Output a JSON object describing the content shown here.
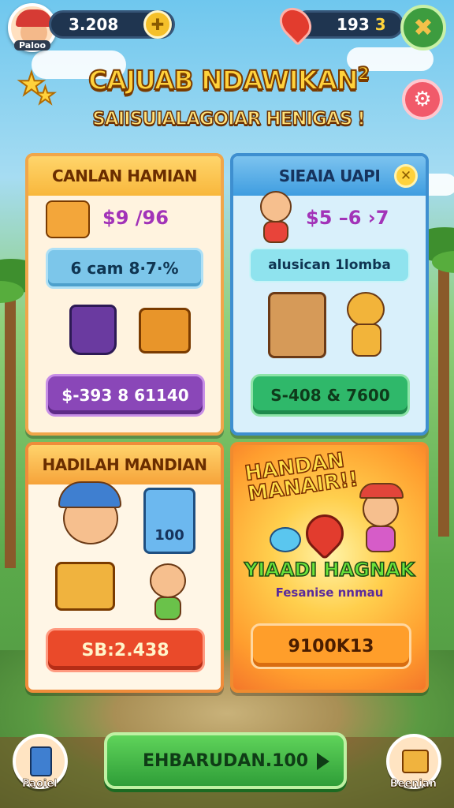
{
  "topbar": {
    "player_name": "Paloo",
    "coins": "3.208",
    "gems_prefix": "193",
    "gems_suffix": "3"
  },
  "title": "CAJUAB NDAWIKAN",
  "title_sup": "2",
  "subtitle": "SAIISUIALAGOIAR HENIGAS !",
  "cards": {
    "card1": {
      "header": "CANLAN HAMIAN",
      "price": "$9 /96",
      "bar": "6 cam 8·7·%",
      "button": "$-393 8 61140"
    },
    "card2": {
      "header": "SIEAIA UAPI",
      "price": "$5 –6 ›7",
      "bar": "alusican 1lomba",
      "button": "S-408 & 7600"
    },
    "card3": {
      "header": "HADILAH MANDIAN",
      "tablet_text": "100",
      "button": "SB:2.438"
    },
    "card4": {
      "header_line1": "HANDAN",
      "header_line2": "MANAIR!!",
      "subheading": "YIAADI HAGNAK",
      "caption": "Fesanise nnmau",
      "button": "9100K13"
    }
  },
  "bottom": {
    "main_button": "EHBARUDAN.100",
    "left_label": "Paoiel",
    "right_label": "Beenian"
  },
  "colors": {
    "title_fill": "#ffd23c",
    "card1_border": "#f0a64a",
    "card2_border": "#3e8fd0",
    "card3_border": "#ef8c3a",
    "bottom_button": "#2f9e38"
  },
  "icons": [
    "coin-icon",
    "heart-icon",
    "map-icon",
    "star-icon",
    "settings-icon",
    "close-icon",
    "arrow-right-icon"
  ]
}
